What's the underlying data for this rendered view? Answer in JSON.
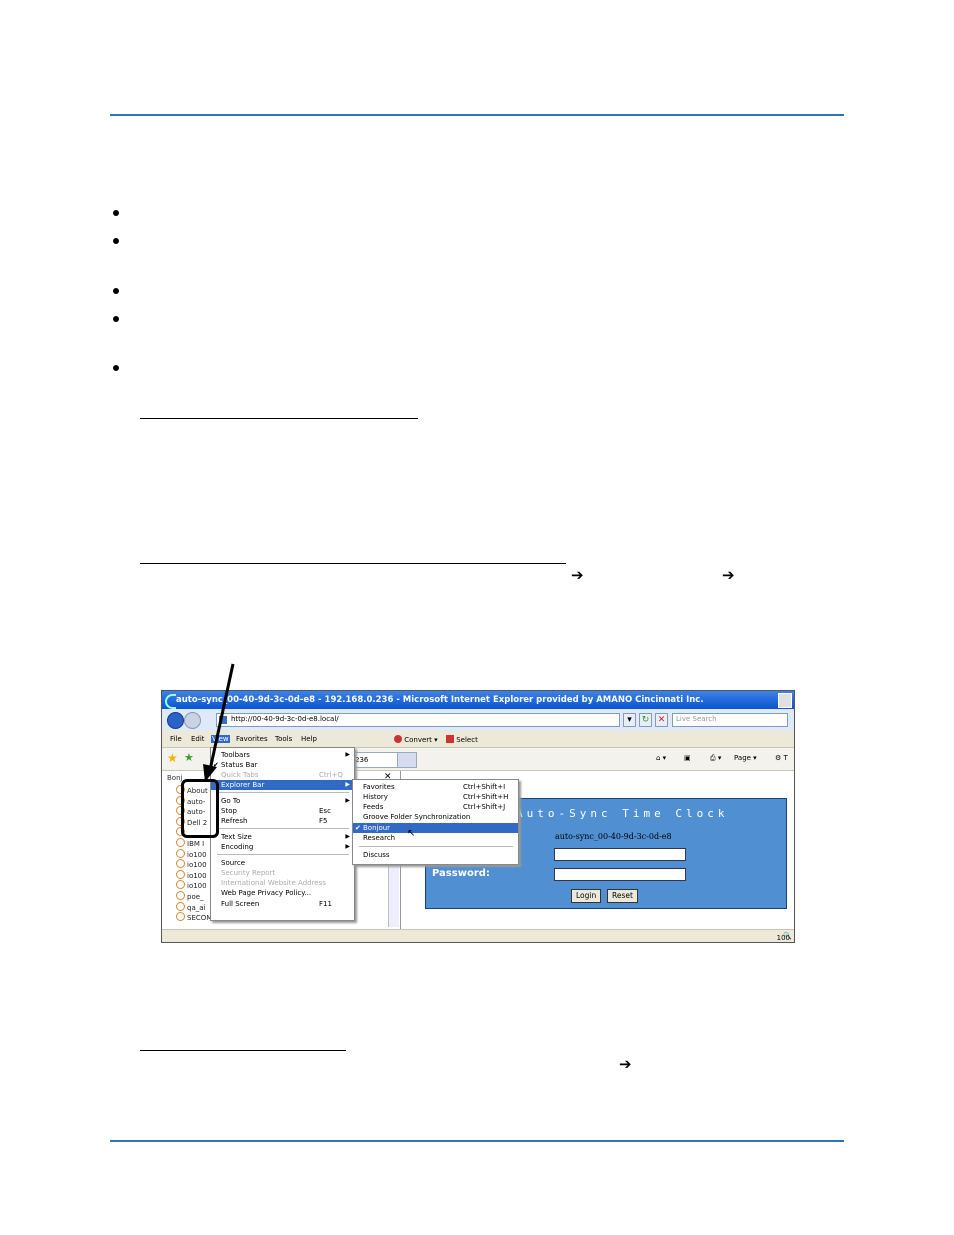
{
  "browser": {
    "window_title": "auto-sync_00-40-9d-3c-0d-e8 - 192.168.0.236 - Microsoft Internet Explorer provided by AMANO Cincinnati Inc.",
    "address": "http://00-40-9d-3c-0d-e8.local/",
    "search_placeholder": "Live Search",
    "menu": [
      "File",
      "Edit",
      "View",
      "Favorites",
      "Tools",
      "Help"
    ],
    "toolbar_convert": "Convert",
    "toolbar_select": "Select",
    "tab_label": "236",
    "page_label": "Page",
    "tools_label": "T",
    "left_pane_header": "Bonj",
    "left_items": [
      "About",
      "auto-",
      "auto-",
      "Dell 2",
      "",
      "IBM I",
      "io100",
      "io100",
      "io100",
      "io100",
      "poe_",
      "qa_ai",
      "SECOM SM 1009"
    ],
    "status_zoom": "100",
    "view_menu": [
      {
        "label": "Toolbars",
        "shortcut": "",
        "arrow": true,
        "check": false,
        "disabled": false
      },
      {
        "label": "Status Bar",
        "shortcut": "",
        "arrow": false,
        "check": true,
        "disabled": false
      },
      {
        "label": "Quick Tabs",
        "shortcut": "Ctrl+Q",
        "arrow": false,
        "check": false,
        "disabled": true
      },
      {
        "label": "Explorer Bar",
        "shortcut": "",
        "arrow": true,
        "check": false,
        "disabled": false,
        "highlight": true
      },
      {
        "label": "Go To",
        "shortcut": "",
        "arrow": true,
        "check": false,
        "disabled": false
      },
      {
        "label": "Stop",
        "shortcut": "Esc",
        "arrow": false,
        "check": false,
        "disabled": false
      },
      {
        "label": "Refresh",
        "shortcut": "F5",
        "arrow": false,
        "check": false,
        "disabled": false
      },
      {
        "label": "Text Size",
        "shortcut": "",
        "arrow": true,
        "check": false,
        "disabled": false
      },
      {
        "label": "Encoding",
        "shortcut": "",
        "arrow": true,
        "check": false,
        "disabled": false
      },
      {
        "label": "Source",
        "shortcut": "",
        "arrow": false,
        "check": false,
        "disabled": false
      },
      {
        "label": "Security Report",
        "shortcut": "",
        "arrow": false,
        "check": false,
        "disabled": true
      },
      {
        "label": "International Website Address",
        "shortcut": "",
        "arrow": false,
        "check": false,
        "disabled": true
      },
      {
        "label": "Web Page Privacy Policy...",
        "shortcut": "",
        "arrow": false,
        "check": false,
        "disabled": false
      },
      {
        "label": "Full Screen",
        "shortcut": "F11",
        "arrow": false,
        "check": false,
        "disabled": false
      }
    ],
    "explorer_submenu": [
      {
        "label": "Favorites",
        "shortcut": "Ctrl+Shift+I"
      },
      {
        "label": "History",
        "shortcut": "Ctrl+Shift+H"
      },
      {
        "label": "Feeds",
        "shortcut": "Ctrl+Shift+J"
      },
      {
        "label": "Groove Folder Synchronization",
        "shortcut": ""
      },
      {
        "label": "Bonjour",
        "shortcut": "",
        "check": true,
        "highlight": true
      },
      {
        "label": "Research",
        "shortcut": ""
      },
      {
        "label": "Discuss",
        "shortcut": ""
      }
    ],
    "login": {
      "title": "Auto-Sync Time Clock",
      "host": "auto-sync_00-40-9d-3c-0d-e8",
      "password_label": "Password:",
      "login_button": "Login",
      "reset_button": "Reset"
    }
  },
  "doc": {
    "arrow_glyph": "➔"
  },
  "colors": {
    "rule": "#2e74b5",
    "panel": "#4f8fd2",
    "highlight": "#316ac5"
  }
}
